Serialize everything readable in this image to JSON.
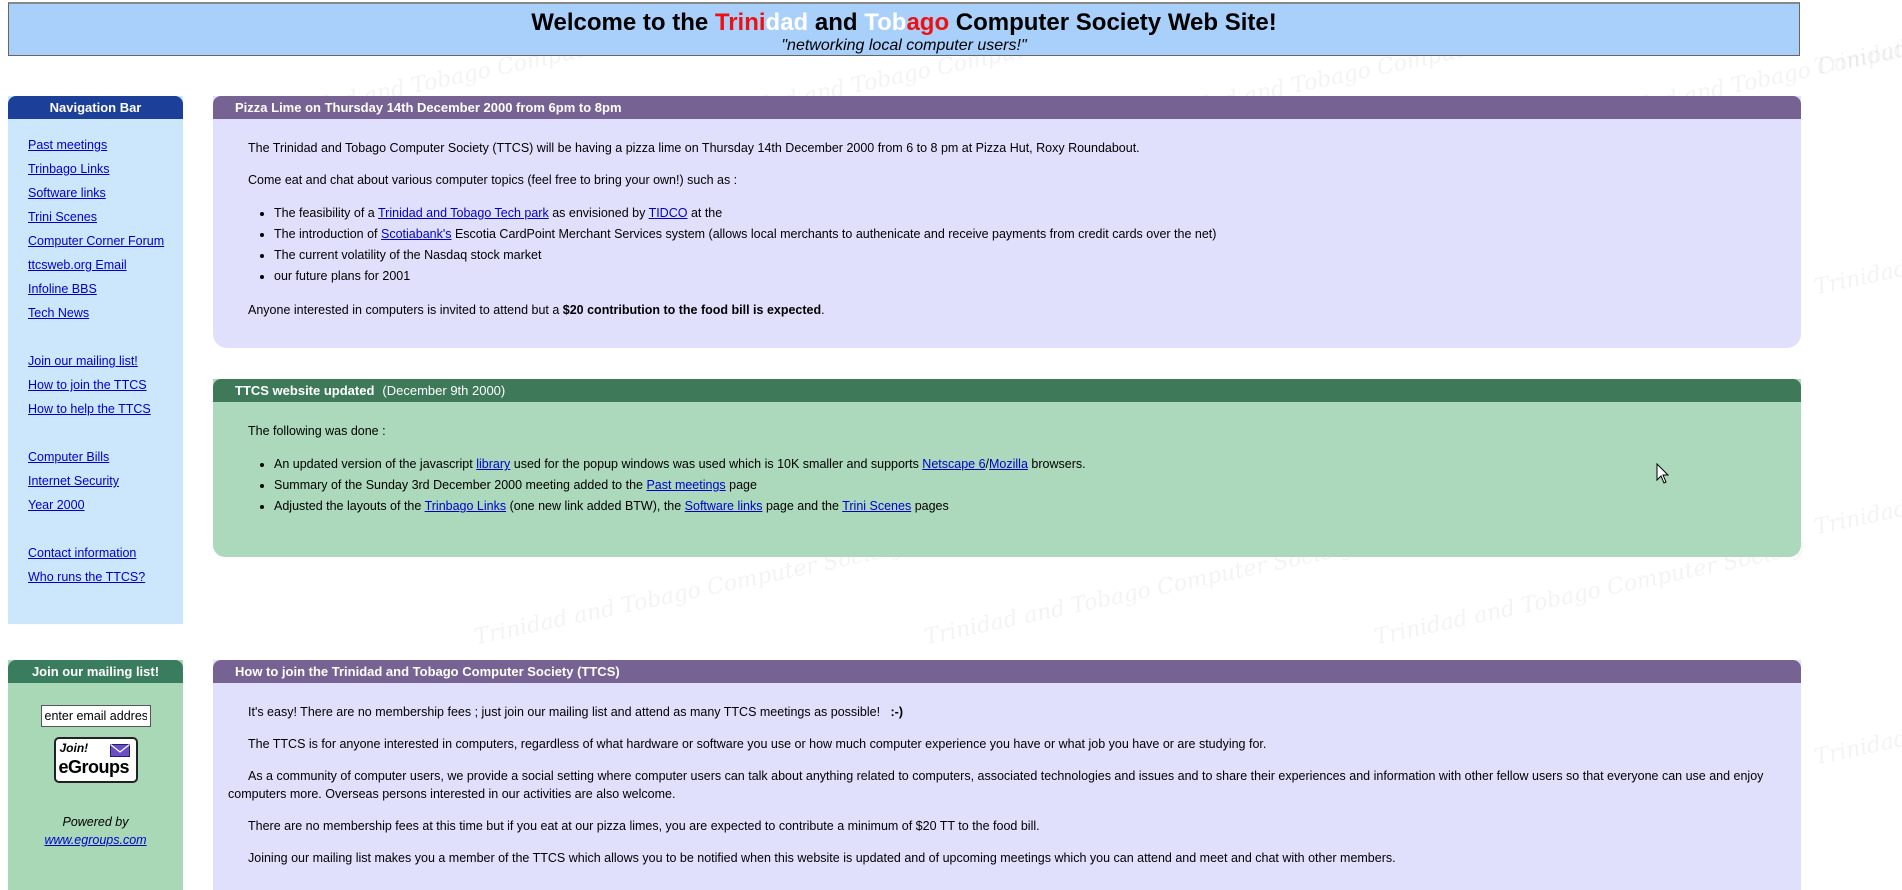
{
  "header": {
    "t_welcome": "Welcome to the ",
    "t_trini": "Trini",
    "t_dad": "dad",
    "t_and": " and ",
    "t_tob": "Tob",
    "t_ago": "ago",
    "t_rest": " Computer Society Web Site!",
    "tagline": "\"networking local computer users!\""
  },
  "watermark": "Trinidad and Tobago Computer Society",
  "nav": {
    "title": "Navigation  Bar",
    "items": [
      "Past meetings",
      "Trinbago Links",
      "Software links",
      "Trini Scenes",
      "Computer Corner Forum",
      "ttcsweb.org Email",
      "Infoline BBS",
      "Tech News",
      "Join our mailing list!",
      "How to join the TTCS",
      "How to help the TTCS",
      "Computer Bills",
      "Internet Security",
      "Year 2000",
      "Contact information",
      "Who runs the TTCS?"
    ]
  },
  "mailing": {
    "title": "Join our mailing list!",
    "email_value": "enter email address",
    "join_line1": "Join!",
    "join_line2": "eGroups",
    "powered_by": "Powered by",
    "link": "www.egroups.com"
  },
  "panel1": {
    "title": "Pizza Lime on Thursday 14th December 2000 from 6pm to 8pm",
    "p1": "The Trinidad and Tobago Computer Society (TTCS) will be having a pizza lime on Thursday 14th December 2000 from 6 to 8 pm at Pizza Hut, Roxy Roundabout.",
    "p2": "Come eat and chat about various computer topics (feel free to bring your own!) such as :",
    "b1_a": "The feasibility of a ",
    "b1_link1": "Trinidad and Tobago Tech park",
    "b1_b": " as envisioned by ",
    "b1_link2": "TIDCO",
    "b1_c": " at the",
    "b2_a": "The introduction of ",
    "b2_link": "Scotiabank's",
    "b2_b": " Escotia CardPoint Merchant Services system (allows local merchants to authenicate and receive payments from credit cards over the net)",
    "b3": "The current volatility of the Nasdaq stock market",
    "b4": "our future plans for 2001",
    "p3_a": "Anyone interested in computers is invited to attend but a ",
    "p3_bold": "$20 contribution to the food bill is expected",
    "p3_end": "."
  },
  "panel2": {
    "title": "TTCS website updated",
    "date": "(December 9th  2000)",
    "p1": "The following was done :",
    "b1_a": "An updated version of the javascript ",
    "b1_link1": "library",
    "b1_b": " used for the popup windows was used which is 10K smaller and supports ",
    "b1_link2": "Netscape 6",
    "b1_sep": "/",
    "b1_link3": "Mozilla",
    "b1_c": " browsers.",
    "b2_a": "Summary of the Sunday 3rd December 2000 meeting added to the ",
    "b2_link": "Past meetings",
    "b2_b": " page",
    "b3_a": "Adjusted the layouts of the ",
    "b3_link1": "Trinbago Links",
    "b3_b": " (one new link added BTW), the ",
    "b3_link2": "Software links",
    "b3_c": " page and the ",
    "b3_link3": "Trini Scenes",
    "b3_d": " pages"
  },
  "panel3": {
    "title": "How  to  join  the  Trinidad and Tobago Computer Society   (TTCS)",
    "p1": "It's easy! There are no membership fees ; just join our mailing list and attend as many TTCS meetings as possible!",
    "p1_smile": ":-)",
    "p2": "The TTCS is for anyone interested in computers, regardless of what hardware or software you use or how much computer experience you have or what job you have or are studying for.",
    "p3": "As a community of computer users, we provide a social setting where computer users can talk about anything related to computers, associated technologies and issues and to share their experiences and information with other fellow users so that everyone can use and enjoy computers more. Overseas persons interested in our activities are also welcome.",
    "p4": "There are no membership fees at this time but if you eat at our pizza limes, you are expected to contribute a minimum of $20 TT to the food bill.",
    "p5": "Joining our mailing list makes you a member of the TTCS which allows you to be notified when this website is updated and of upcoming meetings which you can attend and meet and chat with other members."
  }
}
